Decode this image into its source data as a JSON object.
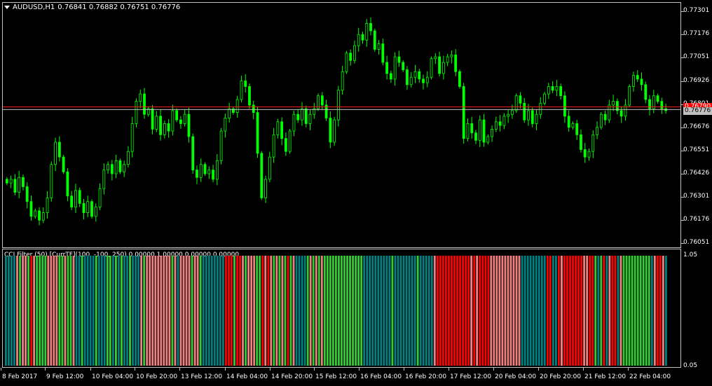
{
  "symbol": {
    "name": "AUDUSD,H1",
    "ohlc": "0.76841 0.76882 0.76751 0.76776"
  },
  "indicator": {
    "title": "CCI Filter (50) [CurrTF](100, -100, 250) 0.00000 1.00000 0.00000 0.00000",
    "scale_top": "1.05",
    "scale_bottom": "0.05"
  },
  "price_axis": [
    "0.77301",
    "0.77176",
    "0.77051",
    "0.76926",
    "0.76801",
    "0.76676",
    "0.76551",
    "0.76426",
    "0.76301",
    "0.76176",
    "0.76051"
  ],
  "bid_badge": "0.76776",
  "ask_badge": "0.76790",
  "time_axis": [
    "8 Feb 2017",
    "9 Feb 12:00",
    "10 Feb 04:00",
    "10 Feb 20:00",
    "13 Feb 12:00",
    "14 Feb 04:00",
    "14 Feb 20:00",
    "15 Feb 12:00",
    "16 Feb 04:00",
    "16 Feb 20:00",
    "17 Feb 12:00",
    "20 Feb 04:00",
    "20 Feb 20:00",
    "21 Feb 12:00",
    "22 Feb 04:00"
  ],
  "colors": {
    "candle": "#00ff00",
    "ask_line": "#ff2020",
    "bid_line": "#c0c0c0",
    "hist_teal": "#008080",
    "hist_green": "#32cd32",
    "hist_salmon": "#f08080",
    "hist_red": "#ff0000"
  },
  "chart_data": {
    "type": "candlestick",
    "ylim": [
      0.76026,
      0.77351
    ],
    "closes": [
      0.7638,
      0.764,
      0.7633,
      0.7641,
      0.7636,
      0.7628,
      0.762,
      0.7623,
      0.7618,
      0.7622,
      0.763,
      0.7648,
      0.766,
      0.7652,
      0.7644,
      0.7631,
      0.7625,
      0.7634,
      0.7627,
      0.7622,
      0.7628,
      0.762,
      0.7625,
      0.7635,
      0.7645,
      0.7648,
      0.7643,
      0.765,
      0.7644,
      0.7648,
      0.7655,
      0.767,
      0.7682,
      0.7686,
      0.7675,
      0.7678,
      0.7667,
      0.7674,
      0.7664,
      0.767,
      0.7666,
      0.7677,
      0.7672,
      0.767,
      0.7675,
      0.7663,
      0.7645,
      0.7641,
      0.7648,
      0.7643,
      0.7645,
      0.764,
      0.765,
      0.7666,
      0.7673,
      0.7678,
      0.7676,
      0.7683,
      0.7693,
      0.769,
      0.768,
      0.7676,
      0.7654,
      0.763,
      0.764,
      0.7652,
      0.7664,
      0.7671,
      0.7662,
      0.7655,
      0.7666,
      0.7675,
      0.7672,
      0.7678,
      0.767,
      0.7675,
      0.7678,
      0.7685,
      0.768,
      0.7673,
      0.766,
      0.7672,
      0.7688,
      0.7698,
      0.7708,
      0.7704,
      0.7712,
      0.7718,
      0.7715,
      0.7724,
      0.772,
      0.771,
      0.7713,
      0.7703,
      0.7697,
      0.7694,
      0.7706,
      0.7703,
      0.7699,
      0.7691,
      0.7695,
      0.7698,
      0.7694,
      0.7692,
      0.7695,
      0.7705,
      0.7706,
      0.7697,
      0.7703,
      0.7706,
      0.7707,
      0.7698,
      0.769,
      0.7662,
      0.767,
      0.7665,
      0.7661,
      0.7672,
      0.766,
      0.7663,
      0.7667,
      0.7671,
      0.7669,
      0.7674,
      0.7675,
      0.7677,
      0.7685,
      0.7681,
      0.7672,
      0.7677,
      0.767,
      0.7675,
      0.7681,
      0.7686,
      0.769,
      0.7688,
      0.769,
      0.7685,
      0.7674,
      0.7668,
      0.767,
      0.7664,
      0.7656,
      0.7652,
      0.7655,
      0.7664,
      0.7668,
      0.7675,
      0.7672,
      0.768,
      0.7682,
      0.7677,
      0.7674,
      0.768,
      0.769,
      0.7696,
      0.7694,
      0.7691,
      0.7683,
      0.7678,
      0.7685,
      0.7682,
      0.7678,
      0.7677
    ],
    "histogram_pattern": "ttttsgssgrsggggssssggsggsttgttttgtttggtgtgttgtttsgsssssssssgstssssgssgttttttttrrrgrrsgsssggrsrsgsgsgrgsttttgsgsgsggggggggggggggttttttttttgttttttttgtttttsrrrrrrrrrrrrsrsrrrrssssssssssstttttttttrrttrsrrrrrrrssrrgtgrtsrrtsggggggggggtsrrst"
  }
}
